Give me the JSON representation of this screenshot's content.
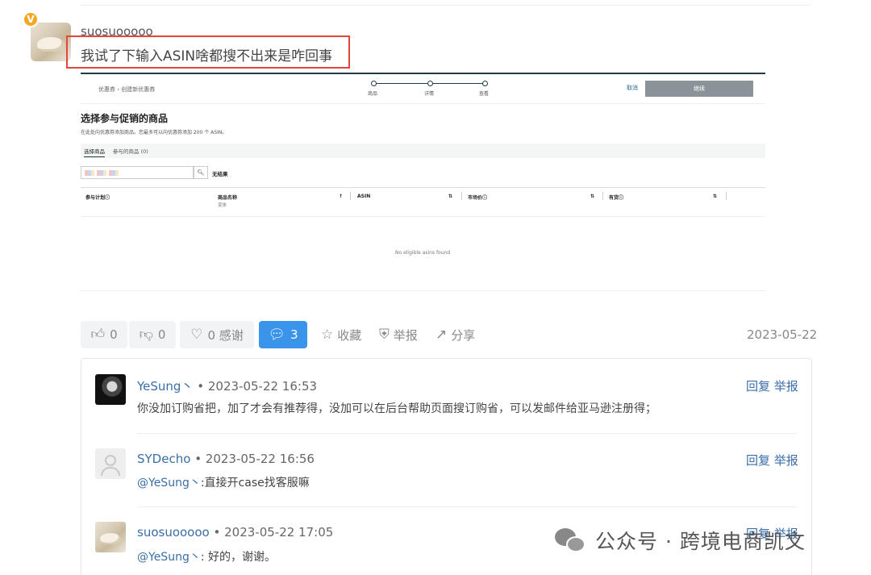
{
  "post": {
    "badge": "V",
    "author": "suosuooooo",
    "question": "我试了下输入ASIN啥都搜不出来是咋回事",
    "date": "2023-05-22"
  },
  "embedded_screenshot": {
    "breadcrumb": "优惠券 › 创建新优惠券",
    "steps": [
      "商品",
      "详情",
      "查看"
    ],
    "cancel": "取消",
    "continue": "继续",
    "title": "选择参与促销的商品",
    "description": "在此处向优惠券添加商品。您最多可以向优惠券添加 200 个 ASIN。",
    "tabs": [
      "选择商品",
      "参与的商品 (0)"
    ],
    "no_result": "无结果",
    "search_icon": "search-icon",
    "columns": [
      "参与计划ⓘ",
      "商品名称",
      "ASIN",
      "市场价ⓘ",
      "有货ⓘ"
    ],
    "column_sub": "变体",
    "sort_glyphs": [
      "↑",
      "⇅",
      "⇅",
      "⇅"
    ],
    "empty_message": "No eligible asins found"
  },
  "actions": {
    "like_count": "0",
    "dislike_count": "0",
    "thanks": "0 感谢",
    "comments_count": "3",
    "favorite": "收藏",
    "report": "举报",
    "share": "分享"
  },
  "comments": [
    {
      "name": "YeSung丶",
      "time": "• 2023-05-22 16:53",
      "text": "你没加订购省把，加了才会有推荐得，没加可以在后台帮助页面搜订购省，可以发邮件给亚马逊注册得；",
      "mention": "",
      "reply": "回复",
      "report": "举报"
    },
    {
      "name": "SYDecho",
      "time": "• 2023-05-22 16:56",
      "mention": "@YeSung丶",
      "text": ":直接开case找客服嘛",
      "reply": "回复",
      "report": "举报"
    },
    {
      "name": "suosuooooo",
      "time": "• 2023-05-22 17:05",
      "mention": "@YeSung丶",
      "text": ": 好的，谢谢。",
      "reply": "回复",
      "report": "举报"
    }
  ],
  "watermark": "公众号 · 跨境电商凯文"
}
